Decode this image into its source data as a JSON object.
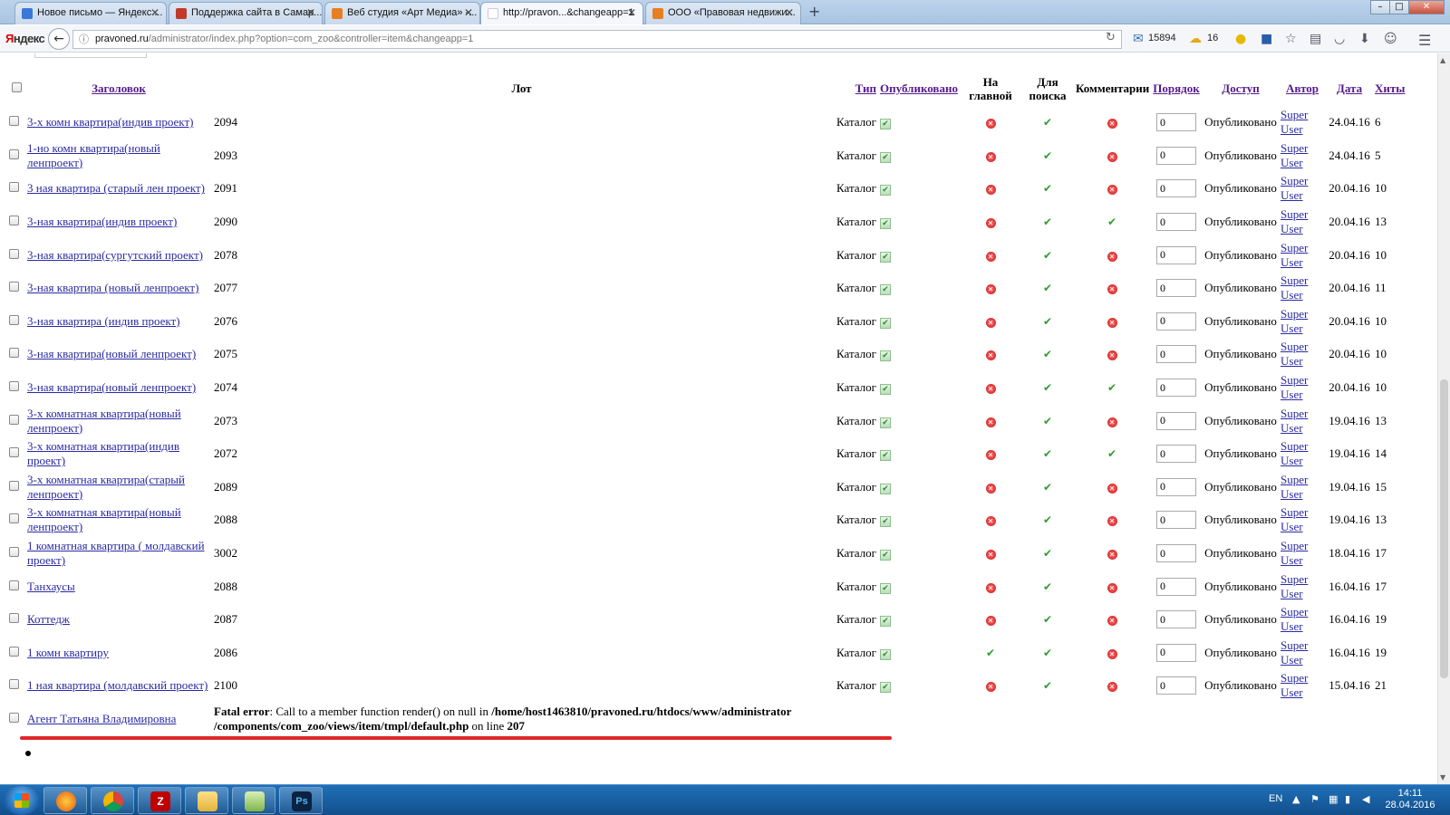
{
  "browser": {
    "tabs": [
      {
        "label": "Новое письмо — Яндекс....",
        "fav_color": "#3b78d8"
      },
      {
        "label": "Поддержка сайта в Самар...",
        "fav_color": "#c0392b",
        "fav_text": "АRT"
      },
      {
        "label": "Веб студия «Арт Медиа» -...",
        "fav_color": "#e67e22"
      },
      {
        "label": "http://pravon...&changeapp=1",
        "fav_color": "#ffffff",
        "active": true
      },
      {
        "label": "ООО «Правовая недвижи...",
        "fav_color": "#e67e22"
      }
    ],
    "brand": "Яндекс",
    "url_host": "pravoned.ru",
    "url_path": "/administrator/index.php?option=com_zoo&controller=item&changeapp=1",
    "mail_count": "15894",
    "temperature": "16"
  },
  "table": {
    "headers": {
      "title": "Заголовок",
      "lot": "Лот",
      "type": "Тип",
      "published": "Опубликовано",
      "frontpage": "На главной",
      "search": "Для поиска",
      "comments": "Комментарии",
      "order": "Порядок",
      "access": "Доступ",
      "author": "Автор",
      "date": "Дата",
      "hits": "Хиты"
    },
    "rows": [
      {
        "title": "3-х комн квартира(индив проект)",
        "lot": "2094",
        "type": "Каталог",
        "frontpage": false,
        "search": true,
        "comments": false,
        "order": "0",
        "access": "Опубликовано",
        "author": "Super User",
        "date": "24.04.16",
        "hits": "6"
      },
      {
        "title": "1-но комн квартира(новый ленпроект)",
        "lot": "2093",
        "type": "Каталог",
        "frontpage": false,
        "search": true,
        "comments": false,
        "order": "0",
        "access": "Опубликовано",
        "author": "Super User",
        "date": "24.04.16",
        "hits": "5"
      },
      {
        "title": "3 ная квартира (старый лен проект)",
        "lot": "2091",
        "type": "Каталог",
        "frontpage": false,
        "search": true,
        "comments": false,
        "order": "0",
        "access": "Опубликовано",
        "author": "Super User",
        "date": "20.04.16",
        "hits": "10"
      },
      {
        "title": "3-ная квартира(индив проект)",
        "lot": "2090",
        "type": "Каталог",
        "frontpage": false,
        "search": true,
        "comments": true,
        "order": "0",
        "access": "Опубликовано",
        "author": "Super User",
        "date": "20.04.16",
        "hits": "13"
      },
      {
        "title": "3-ная квартира(сургутский проект)",
        "lot": "2078",
        "type": "Каталог",
        "frontpage": false,
        "search": true,
        "comments": false,
        "order": "0",
        "access": "Опубликовано",
        "author": "Super User",
        "date": "20.04.16",
        "hits": "10"
      },
      {
        "title": "3-ная квартира (новый ленпроект)",
        "lot": "2077",
        "type": "Каталог",
        "frontpage": false,
        "search": true,
        "comments": false,
        "order": "0",
        "access": "Опубликовано",
        "author": "Super User",
        "date": "20.04.16",
        "hits": "11"
      },
      {
        "title": "3-ная квартира (индив проект)",
        "lot": "2076",
        "type": "Каталог",
        "frontpage": false,
        "search": true,
        "comments": false,
        "order": "0",
        "access": "Опубликовано",
        "author": "Super User",
        "date": "20.04.16",
        "hits": "10"
      },
      {
        "title": "3-ная квартира(новый ленпроект)",
        "lot": "2075",
        "type": "Каталог",
        "frontpage": false,
        "search": true,
        "comments": false,
        "order": "0",
        "access": "Опубликовано",
        "author": "Super User",
        "date": "20.04.16",
        "hits": "10"
      },
      {
        "title": "3-ная квартира(новый ленпроект)",
        "lot": "2074",
        "type": "Каталог",
        "frontpage": false,
        "search": true,
        "comments": true,
        "order": "0",
        "access": "Опубликовано",
        "author": "Super User",
        "date": "20.04.16",
        "hits": "10"
      },
      {
        "title": "3-х комнатная квартира(новый ленпроект)",
        "lot": "2073",
        "type": "Каталог",
        "frontpage": false,
        "search": true,
        "comments": false,
        "order": "0",
        "access": "Опубликовано",
        "author": "Super User",
        "date": "19.04.16",
        "hits": "13"
      },
      {
        "title": "3-х комнатная квартира(индив проект)",
        "lot": "2072",
        "type": "Каталог",
        "frontpage": false,
        "search": true,
        "comments": true,
        "order": "0",
        "access": "Опубликовано",
        "author": "Super User",
        "date": "19.04.16",
        "hits": "14"
      },
      {
        "title": "3-х комнатная квартира(старый ленпроект)",
        "lot": "2089",
        "type": "Каталог",
        "frontpage": false,
        "search": true,
        "comments": false,
        "order": "0",
        "access": "Опубликовано",
        "author": "Super User",
        "date": "19.04.16",
        "hits": "15"
      },
      {
        "title": "3-х комнатная квартира(новый ленпроект)",
        "lot": "2088",
        "type": "Каталог",
        "frontpage": false,
        "search": true,
        "comments": false,
        "order": "0",
        "access": "Опубликовано",
        "author": "Super User",
        "date": "19.04.16",
        "hits": "13"
      },
      {
        "title": "1 комнатная квартира ( молдавский проект)",
        "lot": "3002",
        "type": "Каталог",
        "frontpage": false,
        "search": true,
        "comments": false,
        "order": "0",
        "access": "Опубликовано",
        "author": "Super User",
        "date": "18.04.16",
        "hits": "17"
      },
      {
        "title": "Танхаусы",
        "lot": "2088",
        "type": "Каталог",
        "frontpage": false,
        "search": true,
        "comments": false,
        "order": "0",
        "access": "Опубликовано",
        "author": "Super User",
        "date": "16.04.16",
        "hits": "17"
      },
      {
        "title": "Коттедж",
        "lot": "2087",
        "type": "Каталог",
        "frontpage": false,
        "search": true,
        "comments": false,
        "order": "0",
        "access": "Опубликовано",
        "author": "Super User",
        "date": "16.04.16",
        "hits": "19"
      },
      {
        "title": "1 комн квартиру",
        "lot": "2086",
        "type": "Каталог",
        "frontpage": true,
        "search": true,
        "comments": false,
        "order": "0",
        "access": "Опубликовано",
        "author": "Super User",
        "date": "16.04.16",
        "hits": "19"
      },
      {
        "title": "1 ная квартира (молдавский проект)",
        "lot": "2100",
        "type": "Каталог",
        "frontpage": false,
        "search": true,
        "comments": false,
        "order": "0",
        "access": "Опубликовано",
        "author": "Super User",
        "date": "15.04.16",
        "hits": "21"
      }
    ],
    "last_row": {
      "title": "Агент Татьяна Владимировна",
      "error_label": "Fatal error",
      "error_msg": ": Call to a member function render() on null in ",
      "error_path": "/home/host1463810/pravoned.ru/htdocs/www/administrator /components/com_zoo/views/item/tmpl/default.php",
      "error_on_line": " on line ",
      "error_line": "207"
    }
  },
  "taskbar": {
    "lang": "EN",
    "time": "14:11",
    "date": "28.04.2016"
  },
  "colors": {
    "link": "#2a2aa3",
    "yes": "#2e9e2e",
    "no": "#c91515",
    "highlight_line": "#e0282a"
  }
}
